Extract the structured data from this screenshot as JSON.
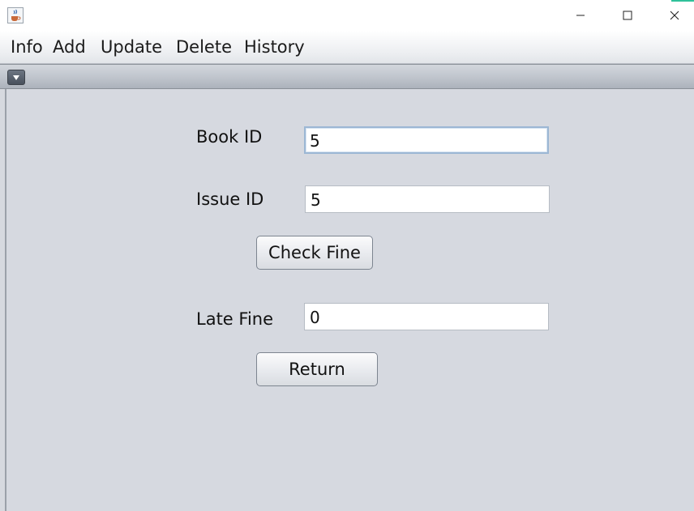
{
  "titlebar": {
    "icons": {
      "app": "java-cup-icon",
      "minimize": "minimize-icon",
      "maximize": "maximize-icon",
      "close": "close-icon"
    }
  },
  "menu": {
    "items": [
      "Info",
      "Add",
      "Update",
      "Delete",
      "History"
    ]
  },
  "form": {
    "book_id_label": "Book ID",
    "book_id_value": "5",
    "issue_id_label": "Issue ID",
    "issue_id_value": "5",
    "check_fine_label": "Check Fine",
    "late_fine_label": "Late Fine",
    "late_fine_value": "0",
    "return_label": "Return"
  },
  "colors": {
    "accent_focus": "#9cb7d4",
    "panel_bg": "#d6d9e0"
  }
}
